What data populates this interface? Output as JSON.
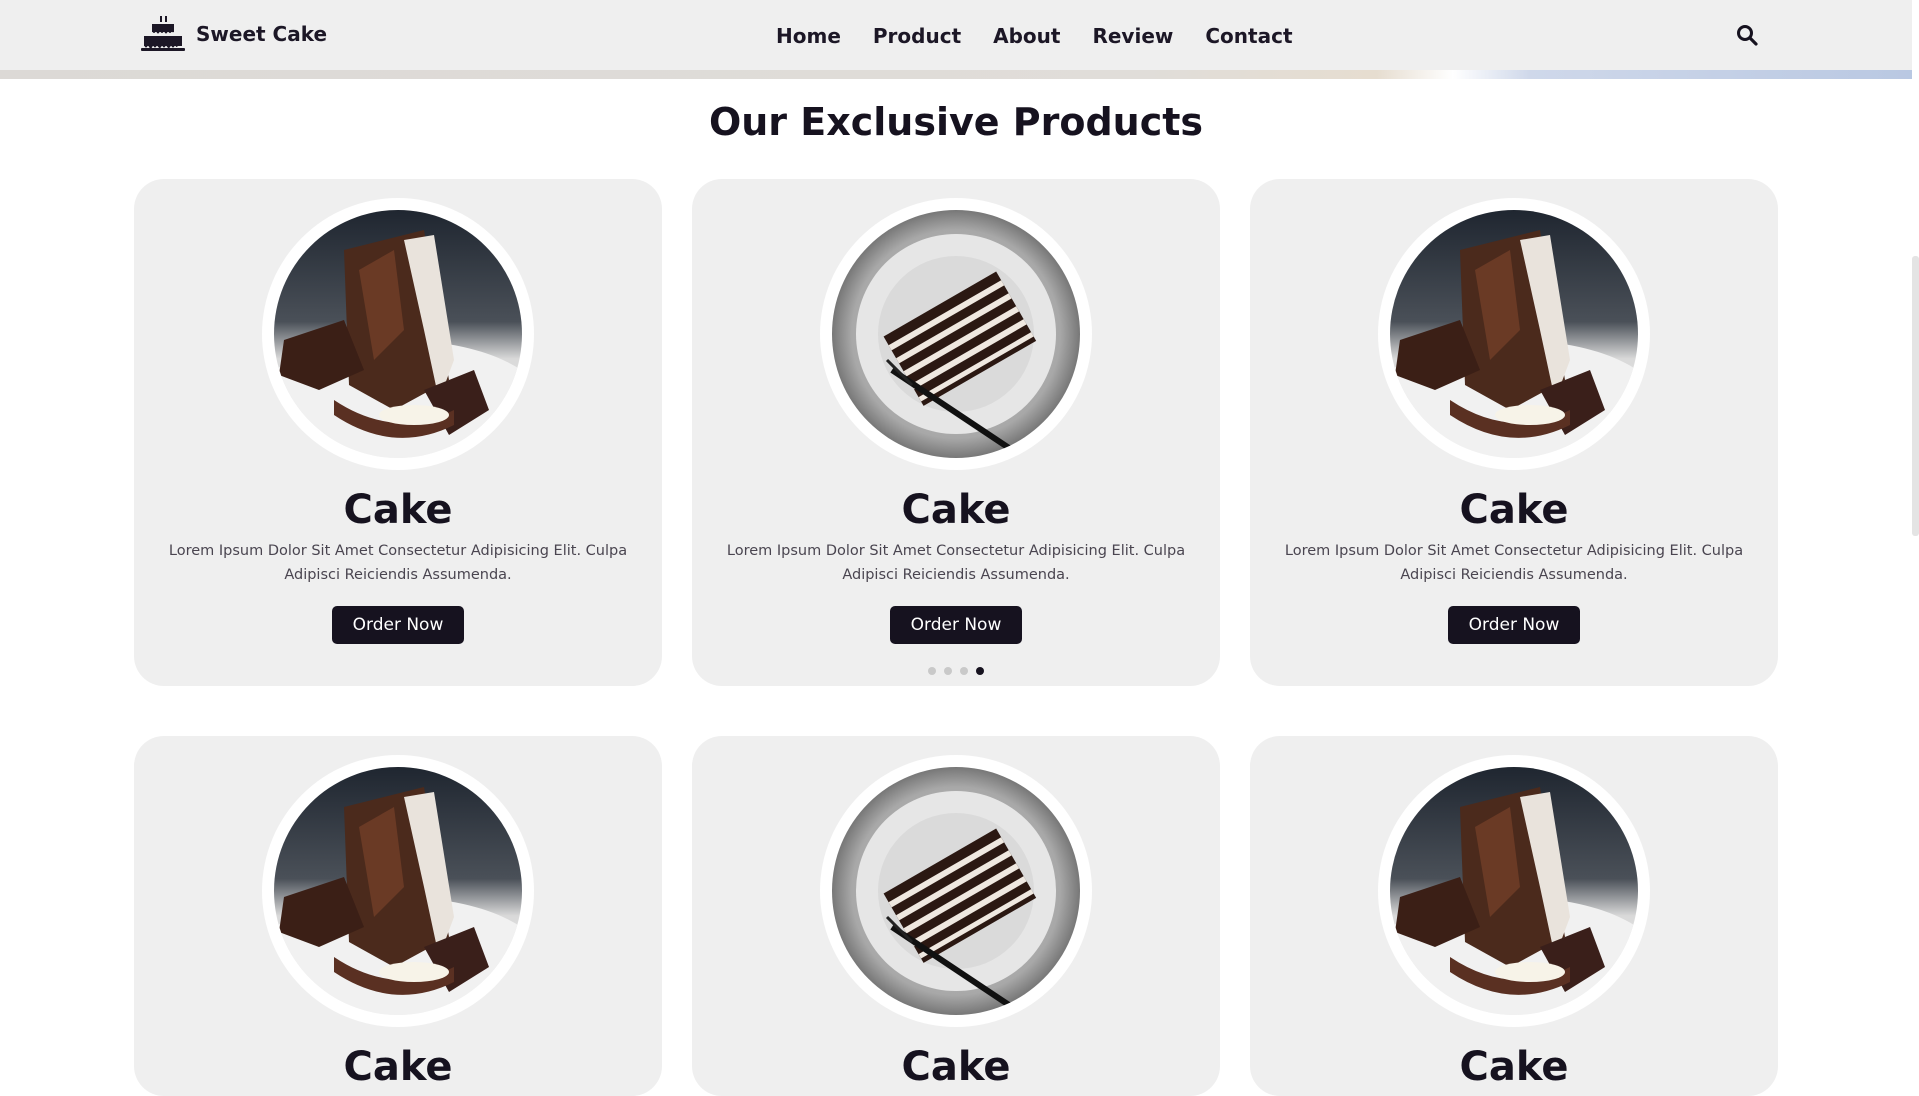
{
  "header": {
    "brand": "Sweet Cake",
    "nav": [
      "Home",
      "Product",
      "About",
      "Review",
      "Contact"
    ],
    "search_icon": "search-icon"
  },
  "section": {
    "title": "Our Exclusive Products"
  },
  "products": [
    {
      "title": "Cake",
      "desc": "Lorem Ipsum Dolor Sit Amet Consectetur Adipisicing Elit. Culpa Adipisci Reiciendis Assumenda.",
      "button": "Order Now",
      "image": "chocolate-lava-cake"
    },
    {
      "title": "Cake",
      "desc": "Lorem Ipsum Dolor Sit Amet Consectetur Adipisicing Elit. Culpa Adipisci Reiciendis Assumenda.",
      "button": "Order Now",
      "image": "layered-cake-slice"
    },
    {
      "title": "Cake",
      "desc": "Lorem Ipsum Dolor Sit Amet Consectetur Adipisicing Elit. Culpa Adipisci Reiciendis Assumenda.",
      "button": "Order Now",
      "image": "chocolate-lava-cake"
    },
    {
      "title": "Cake",
      "image": "chocolate-lava-cake"
    },
    {
      "title": "Cake",
      "image": "layered-cake-slice"
    },
    {
      "title": "Cake",
      "image": "chocolate-lava-cake"
    }
  ],
  "carousel": {
    "count": 4,
    "active_index": 3
  },
  "colors": {
    "accent": "#16121f",
    "card_bg": "#efefef",
    "header_bg": "#efefef"
  }
}
